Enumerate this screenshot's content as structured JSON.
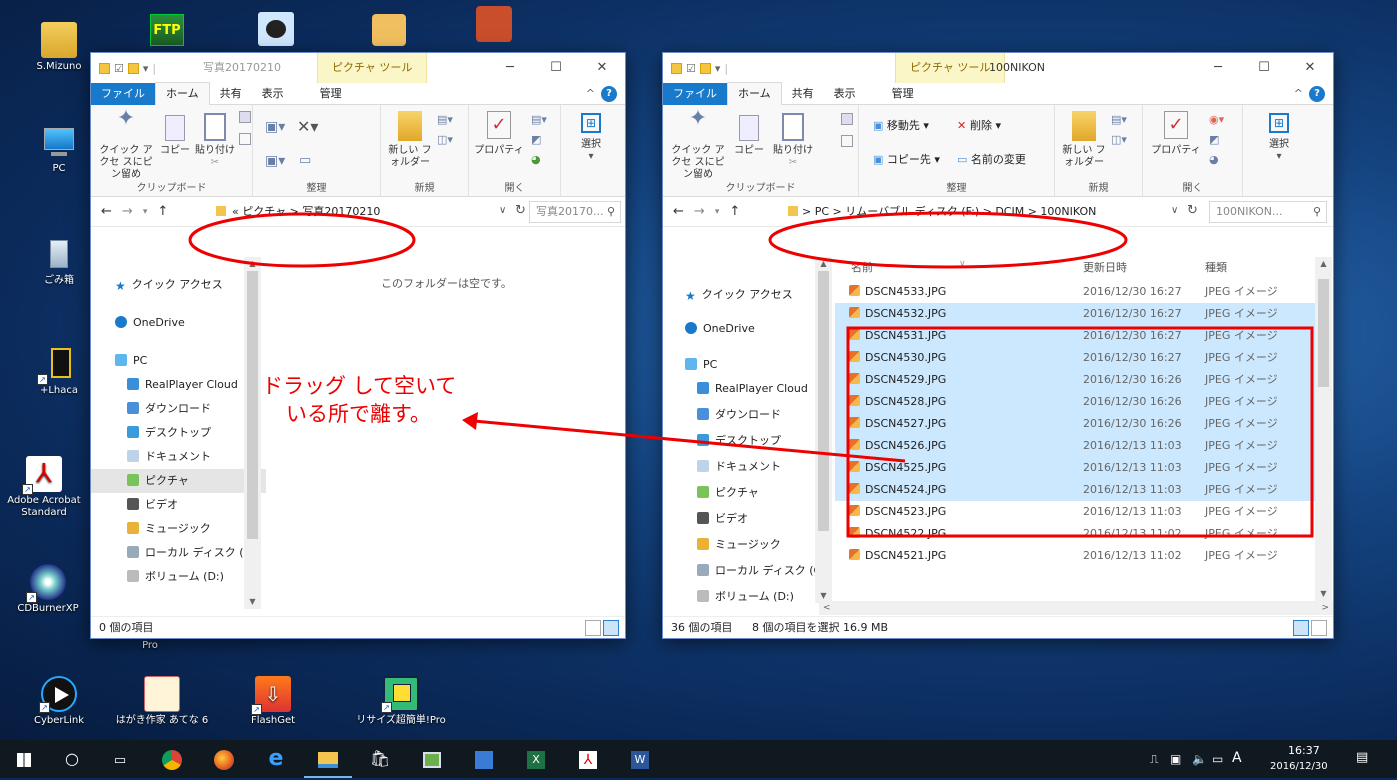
{
  "desktop": {
    "icons": [
      {
        "label": "S.Mizuno",
        "icon": "user-folder-icon"
      },
      {
        "label": "PC",
        "icon": "computer-icon"
      },
      {
        "label": "ごみ箱",
        "icon": "recycle-bin-icon"
      },
      {
        "label": "+Lhaca",
        "icon": "lhaca-icon"
      },
      {
        "label": "Adobe Acrobat Standard",
        "icon": "acrobat-icon"
      },
      {
        "label": "CDBurnerXP",
        "icon": "cdburner-icon"
      },
      {
        "label": "CyberLink",
        "icon": "cyberlink-icon"
      },
      {
        "label": "はがき作家 あてな 6",
        "icon": "hagaki-icon"
      },
      {
        "label": "FlashGet",
        "icon": "flashget-icon"
      },
      {
        "label": "リサイズ超簡単!Pro",
        "icon": "resize-icon"
      },
      {
        "label": "Pro",
        "icon": "pro-label"
      }
    ],
    "topicons": [
      "ftp-icon",
      "manga-icon",
      "frog-icon",
      "game-icon"
    ]
  },
  "leftwin": {
    "title": "写真20170210",
    "context_tab": "ピクチャ ツール",
    "tabs": [
      "ファイル",
      "ホーム",
      "共有",
      "表示",
      "管理"
    ],
    "ribbon": {
      "pin": "クイック アクセ スにピン留め",
      "copy": "コピー",
      "paste": "貼り付け",
      "newfolder": "新しい フォルダー",
      "properties": "プロパティ",
      "select": "選択",
      "g_clipboard": "クリップボード",
      "g_organize": "整理",
      "g_new": "新規",
      "g_open": "開く"
    },
    "address": "« ピクチャ  >  写真20170210",
    "search": "写真20170...",
    "empty_message": "このフォルダーは空です。",
    "nav": [
      "クイック アクセス",
      "OneDrive",
      "PC",
      "RealPlayer Cloud",
      "ダウンロード",
      "デスクトップ",
      "ドキュメント",
      "ピクチャ",
      "ビデオ",
      "ミュージック",
      "ローカル ディスク (C",
      "ボリューム (D:)"
    ],
    "status": "0 個の項目"
  },
  "rightwin": {
    "title": "100NIKON",
    "context_tab": "ピクチャ ツール",
    "tabs": [
      "ファイル",
      "ホーム",
      "共有",
      "表示",
      "管理"
    ],
    "ribbon": {
      "pin": "クイック アクセ スにピン留め",
      "copy": "コピー",
      "paste": "貼り付け",
      "move": "移動先 ▾",
      "delete": "削除 ▾",
      "copyto": "コピー先 ▾",
      "rename": "名前の変更",
      "newfolder": "新しい フォルダー",
      "properties": "プロパティ",
      "select": "選択",
      "g_clipboard": "クリップボード",
      "g_organize": "整理",
      "g_new": "新規",
      "g_open": "開く"
    },
    "address": ">  PC  >  リムーバブル ディスク (F:)  >  DCIM  >  100NIKON",
    "search": "100NIKON...",
    "columns": {
      "name": "名前",
      "date": "更新日時",
      "type": "種類"
    },
    "nav": [
      "クイック アクセス",
      "OneDrive",
      "PC",
      "RealPlayer Cloud",
      "ダウンロード",
      "デスクトップ",
      "ドキュメント",
      "ピクチャ",
      "ビデオ",
      "ミュージック",
      "ローカル ディスク (C",
      "ボリューム (D:)"
    ],
    "files": [
      {
        "name": "DSCN4533.JPG",
        "date": "2016/12/30 16:27",
        "type": "JPEG イメージ",
        "selected": false
      },
      {
        "name": "DSCN4532.JPG",
        "date": "2016/12/30 16:27",
        "type": "JPEG イメージ",
        "selected": true
      },
      {
        "name": "DSCN4531.JPG",
        "date": "2016/12/30 16:27",
        "type": "JPEG イメージ",
        "selected": true
      },
      {
        "name": "DSCN4530.JPG",
        "date": "2016/12/30 16:27",
        "type": "JPEG イメージ",
        "selected": true
      },
      {
        "name": "DSCN4529.JPG",
        "date": "2016/12/30 16:26",
        "type": "JPEG イメージ",
        "selected": true
      },
      {
        "name": "DSCN4528.JPG",
        "date": "2016/12/30 16:26",
        "type": "JPEG イメージ",
        "selected": true
      },
      {
        "name": "DSCN4527.JPG",
        "date": "2016/12/30 16:26",
        "type": "JPEG イメージ",
        "selected": true
      },
      {
        "name": "DSCN4526.JPG",
        "date": "2016/12/13 11:03",
        "type": "JPEG イメージ",
        "selected": true
      },
      {
        "name": "DSCN4525.JPG",
        "date": "2016/12/13 11:03",
        "type": "JPEG イメージ",
        "selected": true
      },
      {
        "name": "DSCN4524.JPG",
        "date": "2016/12/13 11:03",
        "type": "JPEG イメージ",
        "selected": true
      },
      {
        "name": "DSCN4523.JPG",
        "date": "2016/12/13 11:03",
        "type": "JPEG イメージ",
        "selected": false
      },
      {
        "name": "DSCN4522.JPG",
        "date": "2016/12/13 11:02",
        "type": "JPEG イメージ",
        "selected": false
      },
      {
        "name": "DSCN4521.JPG",
        "date": "2016/12/13 11:02",
        "type": "JPEG イメージ",
        "selected": false
      }
    ],
    "status_count": "36 個の項目",
    "status_selected": "8 個の項目を選択 16.9 MB"
  },
  "annotation": {
    "line1": "ドラッグ して空いて",
    "line2": "いる所で離す。",
    "color": "#e00000"
  },
  "taskbar": {
    "time": "16:37",
    "date": "2016/12/30",
    "ime": "A",
    "apps": [
      "start-icon",
      "search-icon",
      "task-view-icon",
      "chrome-icon",
      "firefox-icon",
      "edge-icon",
      "file-explorer-icon",
      "store-icon",
      "photos-icon",
      "app-icon",
      "excel-icon",
      "acrobat-icon",
      "word-icon"
    ]
  }
}
